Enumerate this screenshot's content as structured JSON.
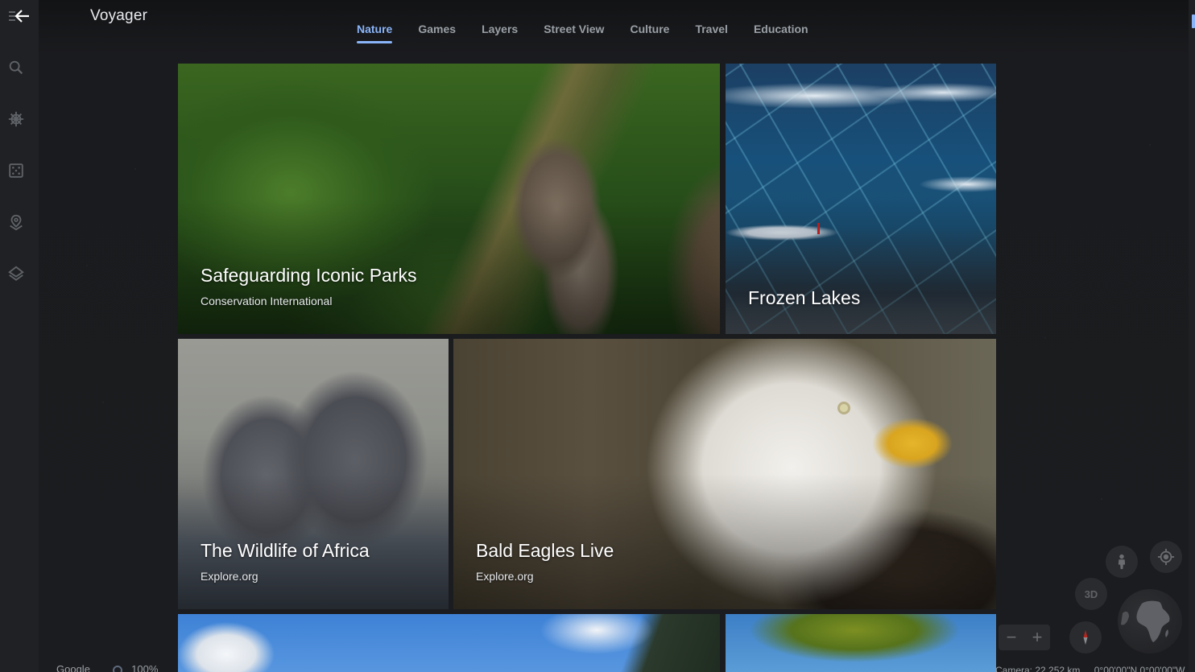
{
  "app": {
    "title": "Voyager"
  },
  "colors": {
    "accent": "#8ab4f8",
    "background": "#17181b",
    "rail": "#202124",
    "inactive_tab": "#9aa0a6"
  },
  "rail": {
    "items": [
      {
        "name": "search",
        "icon": "search-icon"
      },
      {
        "name": "voyager",
        "icon": "ship-wheel-icon"
      },
      {
        "name": "feeling-lucky",
        "icon": "dice-icon"
      },
      {
        "name": "projects",
        "icon": "map-pin-icon"
      },
      {
        "name": "map-style",
        "icon": "layers-icon"
      }
    ]
  },
  "tabs": [
    {
      "label": "Nature",
      "active": true
    },
    {
      "label": "Games",
      "active": false
    },
    {
      "label": "Layers",
      "active": false
    },
    {
      "label": "Street View",
      "active": false
    },
    {
      "label": "Culture",
      "active": false
    },
    {
      "label": "Travel",
      "active": false
    },
    {
      "label": "Education",
      "active": false
    }
  ],
  "cards": [
    {
      "title": "Safeguarding Iconic Parks",
      "subtitle": "Conservation International"
    },
    {
      "title": "Frozen Lakes",
      "subtitle": ""
    },
    {
      "title": "The Wildlife of Africa",
      "subtitle": "Explore.org"
    },
    {
      "title": "Bald Eagles Live",
      "subtitle": "Explore.org"
    },
    {
      "title": "",
      "subtitle": ""
    },
    {
      "title": "",
      "subtitle": ""
    }
  ],
  "map_controls": {
    "three_d_label": "3D",
    "zoom_out": "−",
    "zoom_in": "+"
  },
  "status": {
    "attribution": "Google",
    "zoom_level": "100%",
    "camera": "Camera: 22,252 km",
    "coordinates": "0°00'00\"N 0°00'00\"W"
  }
}
